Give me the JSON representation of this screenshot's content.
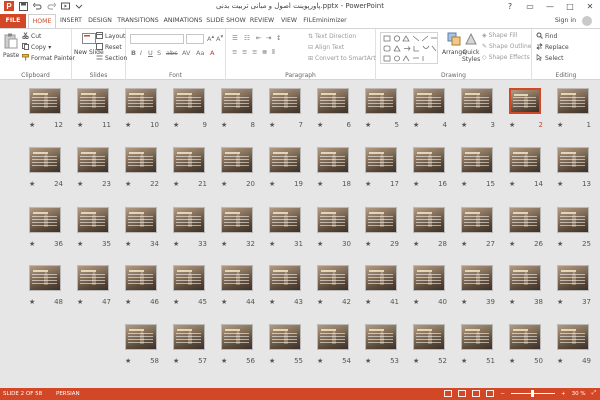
{
  "window": {
    "title": "پاورپوینت اصول و مبانی تربیت بدنی.pptx - PowerPoint",
    "controls": [
      "?",
      "▭",
      "—",
      "□",
      "✕"
    ]
  },
  "tabs": [
    {
      "label": "FILE"
    },
    {
      "label": "HOME"
    },
    {
      "label": "INSERT"
    },
    {
      "label": "DESIGN"
    },
    {
      "label": "TRANSITIONS"
    },
    {
      "label": "ANIMATIONS"
    },
    {
      "label": "SLIDE SHOW"
    },
    {
      "label": "REVIEW"
    },
    {
      "label": "VIEW"
    },
    {
      "label": "FILEminimizer"
    }
  ],
  "active_tab": "HOME",
  "signin": "Sign in",
  "ribbon": {
    "clipboard": {
      "label": "Clipboard",
      "paste": "Paste",
      "cut": "Cut",
      "copy": "Copy",
      "format_painter": "Format Painter"
    },
    "slides": {
      "label": "Slides",
      "new_slide": "New Slide",
      "layout": "Layout",
      "reset": "Reset",
      "section": "Section"
    },
    "font": {
      "label": "Font"
    },
    "paragraph": {
      "label": "Paragraph",
      "text_direction": "Text Direction",
      "align_text": "Align Text",
      "smartart": "Convert to SmartArt"
    },
    "drawing": {
      "label": "Drawing",
      "arrange": "Arrange",
      "quick_styles": "Quick Styles",
      "shape_fill": "Shape Fill",
      "shape_outline": "Shape Outline",
      "shape_effects": "Shape Effects"
    },
    "editing": {
      "label": "Editing",
      "find": "Find",
      "replace": "Replace",
      "select": "Select"
    }
  },
  "slides": {
    "total": 58,
    "selected": 2,
    "rows": [
      [
        12,
        11,
        10,
        9,
        8,
        7,
        6,
        5,
        4,
        3,
        2,
        1
      ],
      [
        24,
        23,
        22,
        21,
        20,
        19,
        18,
        17,
        16,
        15,
        14,
        13
      ],
      [
        36,
        35,
        34,
        33,
        32,
        31,
        30,
        29,
        28,
        27,
        26,
        25
      ],
      [
        48,
        47,
        46,
        45,
        44,
        43,
        42,
        41,
        40,
        39,
        38,
        37
      ],
      [
        58,
        57,
        56,
        55,
        54,
        53,
        52,
        51,
        50,
        49
      ]
    ],
    "star_glyph": "★"
  },
  "status": {
    "slide_indicator": "SLIDE 2 OF 58",
    "language": "PERSIAN",
    "zoom": "30 %"
  },
  "colors": {
    "accent": "#d24726",
    "workspace": "#e6e6e6"
  }
}
